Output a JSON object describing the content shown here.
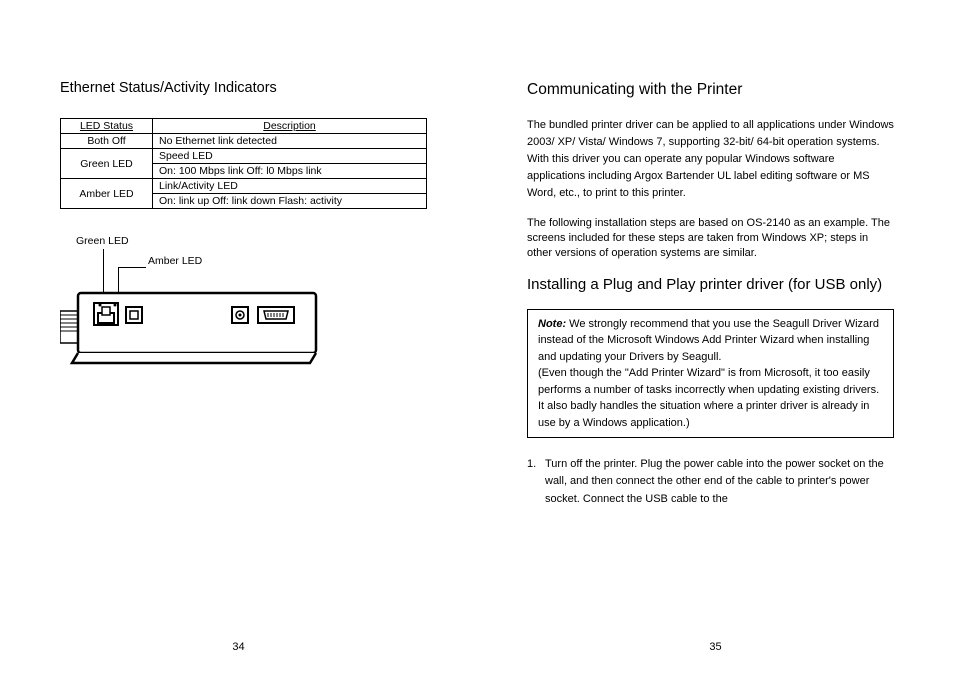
{
  "left": {
    "heading": "Ethernet Status/Activity Indicators",
    "table": {
      "hdr_status": "LED Status",
      "hdr_desc": "Description",
      "r1c1": "Both Off",
      "r1c2": "No Ethernet link detected",
      "r2c1": "Green LED",
      "r2c2a": "Speed LED",
      "r2c2b": "On: 100 Mbps link    Off: l0 Mbps link",
      "r3c1": "Amber LED",
      "r3c2a": "Link/Activity LED",
      "r3c2b": "On: link up    Off: link down    Flash: activity"
    },
    "label_green": "Green LED",
    "label_amber": "Amber LED",
    "pagenum": "34"
  },
  "right": {
    "heading1": "Communicating with the Printer",
    "para1": "The bundled printer driver can be applied to all applications under Windows 2003/ XP/ Vista/ Windows 7, supporting 32-bit/ 64-bit operation systems. With this driver you can operate any popular Windows software applications including Argox Bartender UL label editing software or MS Word, etc., to print to this printer.",
    "para2": "The following installation steps are based on OS-2140 as an example. The screens included for these steps are taken from Windows XP; steps in other versions of operation systems are similar.",
    "heading2": "Installing a Plug and Play printer driver (for USB only)",
    "note_title": "Note:",
    "note_body": "We strongly recommend that you use the Seagull Driver Wizard instead of the Microsoft Windows Add Printer Wizard when installing and updating your Drivers by Seagull.\n(Even though the \"Add Printer Wizard\" is from Microsoft, it too easily performs a number of tasks incorrectly when updating existing drivers. It also badly handles the situation where a printer driver is already in use by a Windows application.)",
    "step1_num": "1.",
    "step1": "Turn off the printer. Plug the power cable into the power socket on the wall, and then connect the other end of the cable to printer's power socket. Connect the USB cable to the",
    "pagenum": "35"
  }
}
